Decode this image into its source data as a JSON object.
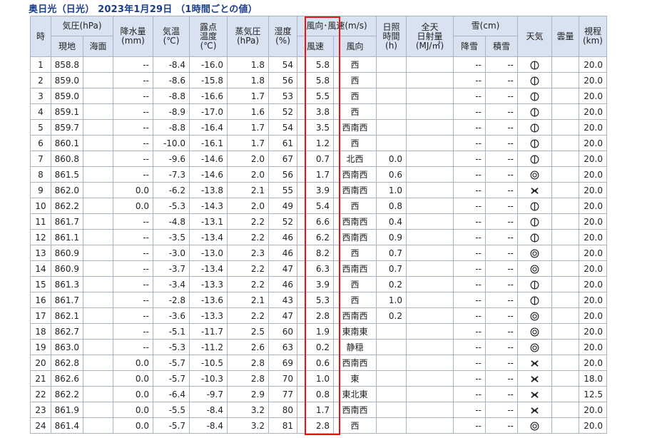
{
  "title": "奥日光（日光） 2023年1月29日 （1時間ごとの値）",
  "headers": {
    "hour": "時",
    "pressure": "気圧(hPa)",
    "pressure_local": "現地",
    "pressure_sea": "海面",
    "precip": "降水量",
    "precip_unit": "(mm)",
    "temp": "気温",
    "temp_unit": "(℃)",
    "dew_a": "露点",
    "dew_b": "温度",
    "dew_unit": "(℃)",
    "vapor": "蒸気圧",
    "vapor_unit": "(hPa)",
    "humidity": "湿度",
    "humidity_unit": "(%)",
    "wind": "風向･風速(m/s)",
    "wind_speed": "風速",
    "wind_dir": "風向",
    "sun_a": "日照",
    "sun_b": "時間",
    "sun_unit": "(h)",
    "rad_a": "全天",
    "rad_b": "日射量",
    "rad_unit": "(MJ/㎡)",
    "snow": "雪(cm)",
    "snow_fall": "降雪",
    "snow_depth": "積雪",
    "weather": "天気",
    "cloud": "雲量",
    "vis": "視程",
    "vis_unit": "(km)"
  },
  "rows": [
    {
      "h": "1",
      "p": "858.8",
      "ps": "",
      "pr": "--",
      "t": "-8.4",
      "dp": "-16.0",
      "vp": "1.8",
      "rh": "54",
      "ws": "5.8",
      "wd": "西",
      "sun": "",
      "rad": "",
      "sf": "--",
      "sd": "--",
      "wx": "cloudy-icon",
      "cl": "",
      "vis": "20.0"
    },
    {
      "h": "2",
      "p": "859.0",
      "ps": "",
      "pr": "--",
      "t": "-8.6",
      "dp": "-15.8",
      "vp": "1.8",
      "rh": "56",
      "ws": "5.8",
      "wd": "西",
      "sun": "",
      "rad": "",
      "sf": "--",
      "sd": "--",
      "wx": "cloudy-icon",
      "cl": "",
      "vis": "20.0"
    },
    {
      "h": "3",
      "p": "859.0",
      "ps": "",
      "pr": "--",
      "t": "-8.8",
      "dp": "-16.6",
      "vp": "1.7",
      "rh": "53",
      "ws": "5.5",
      "wd": "西",
      "sun": "",
      "rad": "",
      "sf": "--",
      "sd": "--",
      "wx": "cloudy-icon",
      "cl": "",
      "vis": "20.0"
    },
    {
      "h": "4",
      "p": "859.1",
      "ps": "",
      "pr": "--",
      "t": "-8.9",
      "dp": "-17.0",
      "vp": "1.6",
      "rh": "52",
      "ws": "3.8",
      "wd": "西",
      "sun": "",
      "rad": "",
      "sf": "--",
      "sd": "--",
      "wx": "cloudy-icon",
      "cl": "",
      "vis": "20.0"
    },
    {
      "h": "5",
      "p": "859.7",
      "ps": "",
      "pr": "--",
      "t": "-8.8",
      "dp": "-16.4",
      "vp": "1.7",
      "rh": "54",
      "ws": "3.5",
      "wd": "西南西",
      "sun": "",
      "rad": "",
      "sf": "--",
      "sd": "--",
      "wx": "cloudy-icon",
      "cl": "",
      "vis": "20.0"
    },
    {
      "h": "6",
      "p": "860.1",
      "ps": "",
      "pr": "--",
      "t": "-10.0",
      "dp": "-16.1",
      "vp": "1.7",
      "rh": "61",
      "ws": "1.2",
      "wd": "西",
      "sun": "",
      "rad": "",
      "sf": "--",
      "sd": "--",
      "wx": "cloudy-icon",
      "cl": "",
      "vis": "20.0"
    },
    {
      "h": "7",
      "p": "860.8",
      "ps": "",
      "pr": "--",
      "t": "-9.6",
      "dp": "-14.6",
      "vp": "2.0",
      "rh": "67",
      "ws": "0.7",
      "wd": "北西",
      "sun": "0.0",
      "rad": "",
      "sf": "--",
      "sd": "--",
      "wx": "cloudy-icon",
      "cl": "",
      "vis": "20.0"
    },
    {
      "h": "8",
      "p": "861.5",
      "ps": "",
      "pr": "--",
      "t": "-7.3",
      "dp": "-14.6",
      "vp": "2.0",
      "rh": "56",
      "ws": "1.7",
      "wd": "西南西",
      "sun": "0.6",
      "rad": "",
      "sf": "--",
      "sd": "--",
      "wx": "fair-icon",
      "cl": "",
      "vis": "20.0"
    },
    {
      "h": "9",
      "p": "862.0",
      "ps": "",
      "pr": "0.0",
      "t": "-6.2",
      "dp": "-13.8",
      "vp": "2.1",
      "rh": "55",
      "ws": "3.9",
      "wd": "西南西",
      "sun": "1.0",
      "rad": "",
      "sf": "--",
      "sd": "--",
      "wx": "snow-icon",
      "cl": "",
      "vis": "20.0"
    },
    {
      "h": "10",
      "p": "862.2",
      "ps": "",
      "pr": "0.0",
      "t": "-5.3",
      "dp": "-14.3",
      "vp": "2.0",
      "rh": "49",
      "ws": "5.4",
      "wd": "西",
      "sun": "0.8",
      "rad": "",
      "sf": "--",
      "sd": "--",
      "wx": "cloudy-icon",
      "cl": "",
      "vis": "20.0"
    },
    {
      "h": "11",
      "p": "861.7",
      "ps": "",
      "pr": "--",
      "t": "-4.8",
      "dp": "-13.1",
      "vp": "2.2",
      "rh": "52",
      "ws": "6.6",
      "wd": "西南西",
      "sun": "0.4",
      "rad": "",
      "sf": "--",
      "sd": "--",
      "wx": "cloudy-icon",
      "cl": "",
      "vis": "20.0"
    },
    {
      "h": "12",
      "p": "861.1",
      "ps": "",
      "pr": "--",
      "t": "-3.5",
      "dp": "-13.4",
      "vp": "2.2",
      "rh": "46",
      "ws": "6.2",
      "wd": "西南西",
      "sun": "0.9",
      "rad": "",
      "sf": "--",
      "sd": "--",
      "wx": "cloudy-icon",
      "cl": "",
      "vis": "20.0"
    },
    {
      "h": "13",
      "p": "860.9",
      "ps": "",
      "pr": "--",
      "t": "-3.0",
      "dp": "-13.0",
      "vp": "2.3",
      "rh": "46",
      "ws": "8.2",
      "wd": "西",
      "sun": "0.7",
      "rad": "",
      "sf": "--",
      "sd": "--",
      "wx": "fair-icon",
      "cl": "",
      "vis": "20.0"
    },
    {
      "h": "14",
      "p": "860.9",
      "ps": "",
      "pr": "--",
      "t": "-3.7",
      "dp": "-13.4",
      "vp": "2.2",
      "rh": "47",
      "ws": "6.3",
      "wd": "西南西",
      "sun": "0.7",
      "rad": "",
      "sf": "--",
      "sd": "--",
      "wx": "fair-icon",
      "cl": "",
      "vis": "20.0"
    },
    {
      "h": "15",
      "p": "861.3",
      "ps": "",
      "pr": "--",
      "t": "-3.4",
      "dp": "-13.3",
      "vp": "2.2",
      "rh": "46",
      "ws": "3.9",
      "wd": "西",
      "sun": "0.2",
      "rad": "",
      "sf": "--",
      "sd": "--",
      "wx": "cloudy-icon",
      "cl": "",
      "vis": "20.0"
    },
    {
      "h": "16",
      "p": "861.7",
      "ps": "",
      "pr": "--",
      "t": "-2.8",
      "dp": "-13.6",
      "vp": "2.1",
      "rh": "43",
      "ws": "5.3",
      "wd": "西",
      "sun": "1.0",
      "rad": "",
      "sf": "--",
      "sd": "--",
      "wx": "cloudy-icon",
      "cl": "",
      "vis": "20.0"
    },
    {
      "h": "17",
      "p": "862.1",
      "ps": "",
      "pr": "--",
      "t": "-3.6",
      "dp": "-13.3",
      "vp": "2.2",
      "rh": "47",
      "ws": "2.8",
      "wd": "西南西",
      "sun": "0.2",
      "rad": "",
      "sf": "--",
      "sd": "--",
      "wx": "fair-icon",
      "cl": "",
      "vis": "20.0"
    },
    {
      "h": "18",
      "p": "862.7",
      "ps": "",
      "pr": "--",
      "t": "-5.1",
      "dp": "-11.7",
      "vp": "2.5",
      "rh": "60",
      "ws": "1.9",
      "wd": "東南東",
      "sun": "",
      "rad": "",
      "sf": "--",
      "sd": "--",
      "wx": "fair-icon",
      "cl": "",
      "vis": "20.0"
    },
    {
      "h": "19",
      "p": "863.0",
      "ps": "",
      "pr": "--",
      "t": "-5.3",
      "dp": "-11.2",
      "vp": "2.6",
      "rh": "63",
      "ws": "0.2",
      "wd": "静穏",
      "sun": "",
      "rad": "",
      "sf": "--",
      "sd": "--",
      "wx": "fair-icon",
      "cl": "",
      "vis": "20.0"
    },
    {
      "h": "20",
      "p": "862.8",
      "ps": "",
      "pr": "0.0",
      "t": "-5.7",
      "dp": "-10.5",
      "vp": "2.8",
      "rh": "69",
      "ws": "0.6",
      "wd": "西南西",
      "sun": "",
      "rad": "",
      "sf": "--",
      "sd": "--",
      "wx": "snow-icon",
      "cl": "",
      "vis": "20.0"
    },
    {
      "h": "21",
      "p": "862.6",
      "ps": "",
      "pr": "0.0",
      "t": "-5.7",
      "dp": "-10.3",
      "vp": "2.8",
      "rh": "70",
      "ws": "1.0",
      "wd": "東",
      "sun": "",
      "rad": "",
      "sf": "--",
      "sd": "--",
      "wx": "snow-icon",
      "cl": "",
      "vis": "18.0"
    },
    {
      "h": "22",
      "p": "862.2",
      "ps": "",
      "pr": "0.0",
      "t": "-6.4",
      "dp": "-9.7",
      "vp": "2.9",
      "rh": "77",
      "ws": "0.8",
      "wd": "東北東",
      "sun": "",
      "rad": "",
      "sf": "--",
      "sd": "--",
      "wx": "snow-icon",
      "cl": "",
      "vis": "12.5"
    },
    {
      "h": "23",
      "p": "861.9",
      "ps": "",
      "pr": "0.0",
      "t": "-5.5",
      "dp": "-8.4",
      "vp": "3.2",
      "rh": "80",
      "ws": "1.7",
      "wd": "西南西",
      "sun": "",
      "rad": "",
      "sf": "--",
      "sd": "--",
      "wx": "snow-icon",
      "cl": "",
      "vis": "20.0"
    },
    {
      "h": "24",
      "p": "861.4",
      "ps": "",
      "pr": "0.0",
      "t": "-5.7",
      "dp": "-8.4",
      "vp": "3.2",
      "rh": "81",
      "ws": "2.8",
      "wd": "西",
      "sun": "",
      "rad": "",
      "sf": "--",
      "sd": "--",
      "wx": "fair-icon",
      "cl": "",
      "vis": "20.0"
    }
  ],
  "colors": {
    "header_bg": "#d9e2f1",
    "title": "#1a3e8a",
    "highlight": "#e11111",
    "border": "#a9b3c4"
  }
}
